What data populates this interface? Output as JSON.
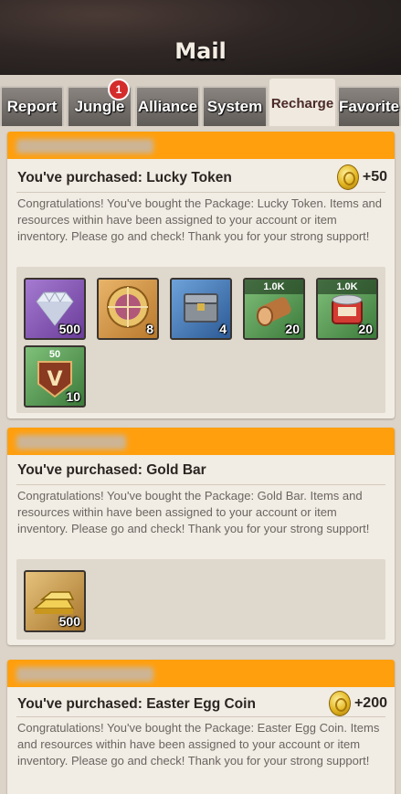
{
  "header": {
    "title": "Mail"
  },
  "tabs": [
    {
      "label": "Report"
    },
    {
      "label": "Jungle",
      "badge": "1"
    },
    {
      "label": "Alliance"
    },
    {
      "label": "System"
    },
    {
      "label": "Recharge",
      "active": true
    },
    {
      "label": "Favorite"
    }
  ],
  "mails": [
    {
      "title": "You've purchased: Lucky Token",
      "reward": "+50",
      "message": "Congratulations! You've bought the Package: Lucky Token. Items and resources within have been assigned to your account or item inventory. Please go and check! Thank you for your strong support!",
      "items": [
        {
          "icon": "diamond-icon",
          "qty": "500",
          "top": ""
        },
        {
          "icon": "compass-medal-icon",
          "qty": "8",
          "top": ""
        },
        {
          "icon": "treasure-chest-icon",
          "qty": "4",
          "top": ""
        },
        {
          "icon": "wood-log-icon",
          "qty": "20",
          "top": "1.0K"
        },
        {
          "icon": "food-can-icon",
          "qty": "20",
          "top": "1.0K"
        },
        {
          "icon": "vip-badge-icon",
          "qty": "10",
          "top": "50"
        }
      ]
    },
    {
      "title": "You've purchased: Gold Bar",
      "reward": "",
      "message": "Congratulations! You've bought the Package: Gold Bar. Items and resources within have been assigned to your account or item inventory. Please go and check! Thank you for your strong support!",
      "items": [
        {
          "icon": "gold-bar-icon",
          "qty": "500",
          "top": ""
        }
      ]
    },
    {
      "title": "You've purchased: Easter Egg Coin",
      "reward": "+200",
      "message": "Congratulations! You've bought the Package: Easter Egg Coin. Items and resources within have been assigned to your account or item inventory. Please go and check! Thank you for your strong support!",
      "items": []
    }
  ],
  "colors": {
    "accent": "#ff9f0e",
    "card": "#f1ece4"
  }
}
